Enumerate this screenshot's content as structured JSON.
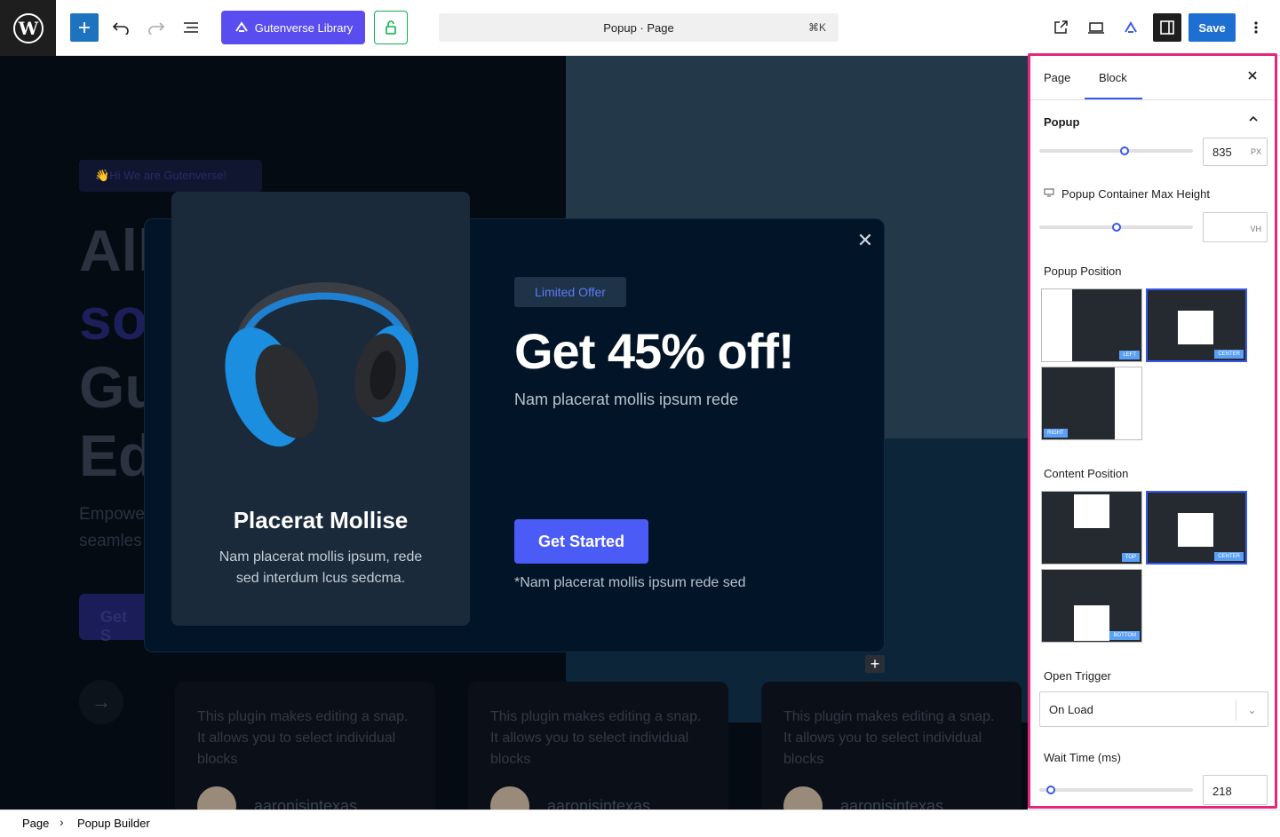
{
  "topbar": {
    "library_label": "Gutenverse Library",
    "document_title": "Popup · Page",
    "shortcut": "⌘K",
    "save_label": "Save"
  },
  "hero": {
    "tag": "👋Hi We are Gutenverse!",
    "lines": [
      "All",
      "so",
      "Gu",
      "Ed"
    ],
    "sub_lines": [
      "Empowe",
      "seamles"
    ],
    "button": "Get S",
    "arrow": "→"
  },
  "popup": {
    "card_title": "Placerat Mollise",
    "card_desc": "Nam placerat mollis ipsum, rede sed interdum lcus sedcma.",
    "badge": "Limited Offer",
    "title": "Get 45% off!",
    "subtitle": "Nam placerat mollis ipsum rede",
    "button": "Get Started",
    "note": "*Nam placerat mollis ipsum rede sed"
  },
  "testimonials": [
    {
      "text": "This plugin makes editing a snap. It allows you to select individual blocks",
      "name": "aaronisintexas"
    },
    {
      "text": "This plugin makes editing a snap. It allows you to select individual blocks",
      "name": "aaronisintexas"
    },
    {
      "text": "This plugin makes editing a snap. It allows you to select individual blocks",
      "name": "aaronisintexas"
    }
  ],
  "sidebar": {
    "tabs": [
      "Page",
      "Block"
    ],
    "active_tab": "Block",
    "section_title": "Popup",
    "width_value": "835",
    "width_unit": "PX",
    "max_height_label": "Popup Container Max Height",
    "max_height_value": "",
    "max_height_unit": "VH",
    "popup_position_label": "Popup Position",
    "popup_positions": [
      "LEFT",
      "CENTER",
      "RIGHT"
    ],
    "popup_position_selected": "CENTER",
    "content_position_label": "Content Position",
    "content_positions": [
      "TOP",
      "CENTER",
      "BOTTOM"
    ],
    "content_position_selected": "CENTER",
    "open_trigger_label": "Open Trigger",
    "open_trigger_value": "On Load",
    "wait_time_label": "Wait Time (ms)",
    "wait_time_value": "218"
  },
  "footer": {
    "breadcrumb": [
      "Page",
      "Popup Builder"
    ],
    "separator": "›"
  },
  "colors": {
    "accent": "#3858e9",
    "save": "#1d6fd1",
    "gutenverse": "#5a4df0",
    "highlight_border": "#e4267d",
    "popup_bg": "#021427",
    "popup_button": "#4a5cf5"
  }
}
